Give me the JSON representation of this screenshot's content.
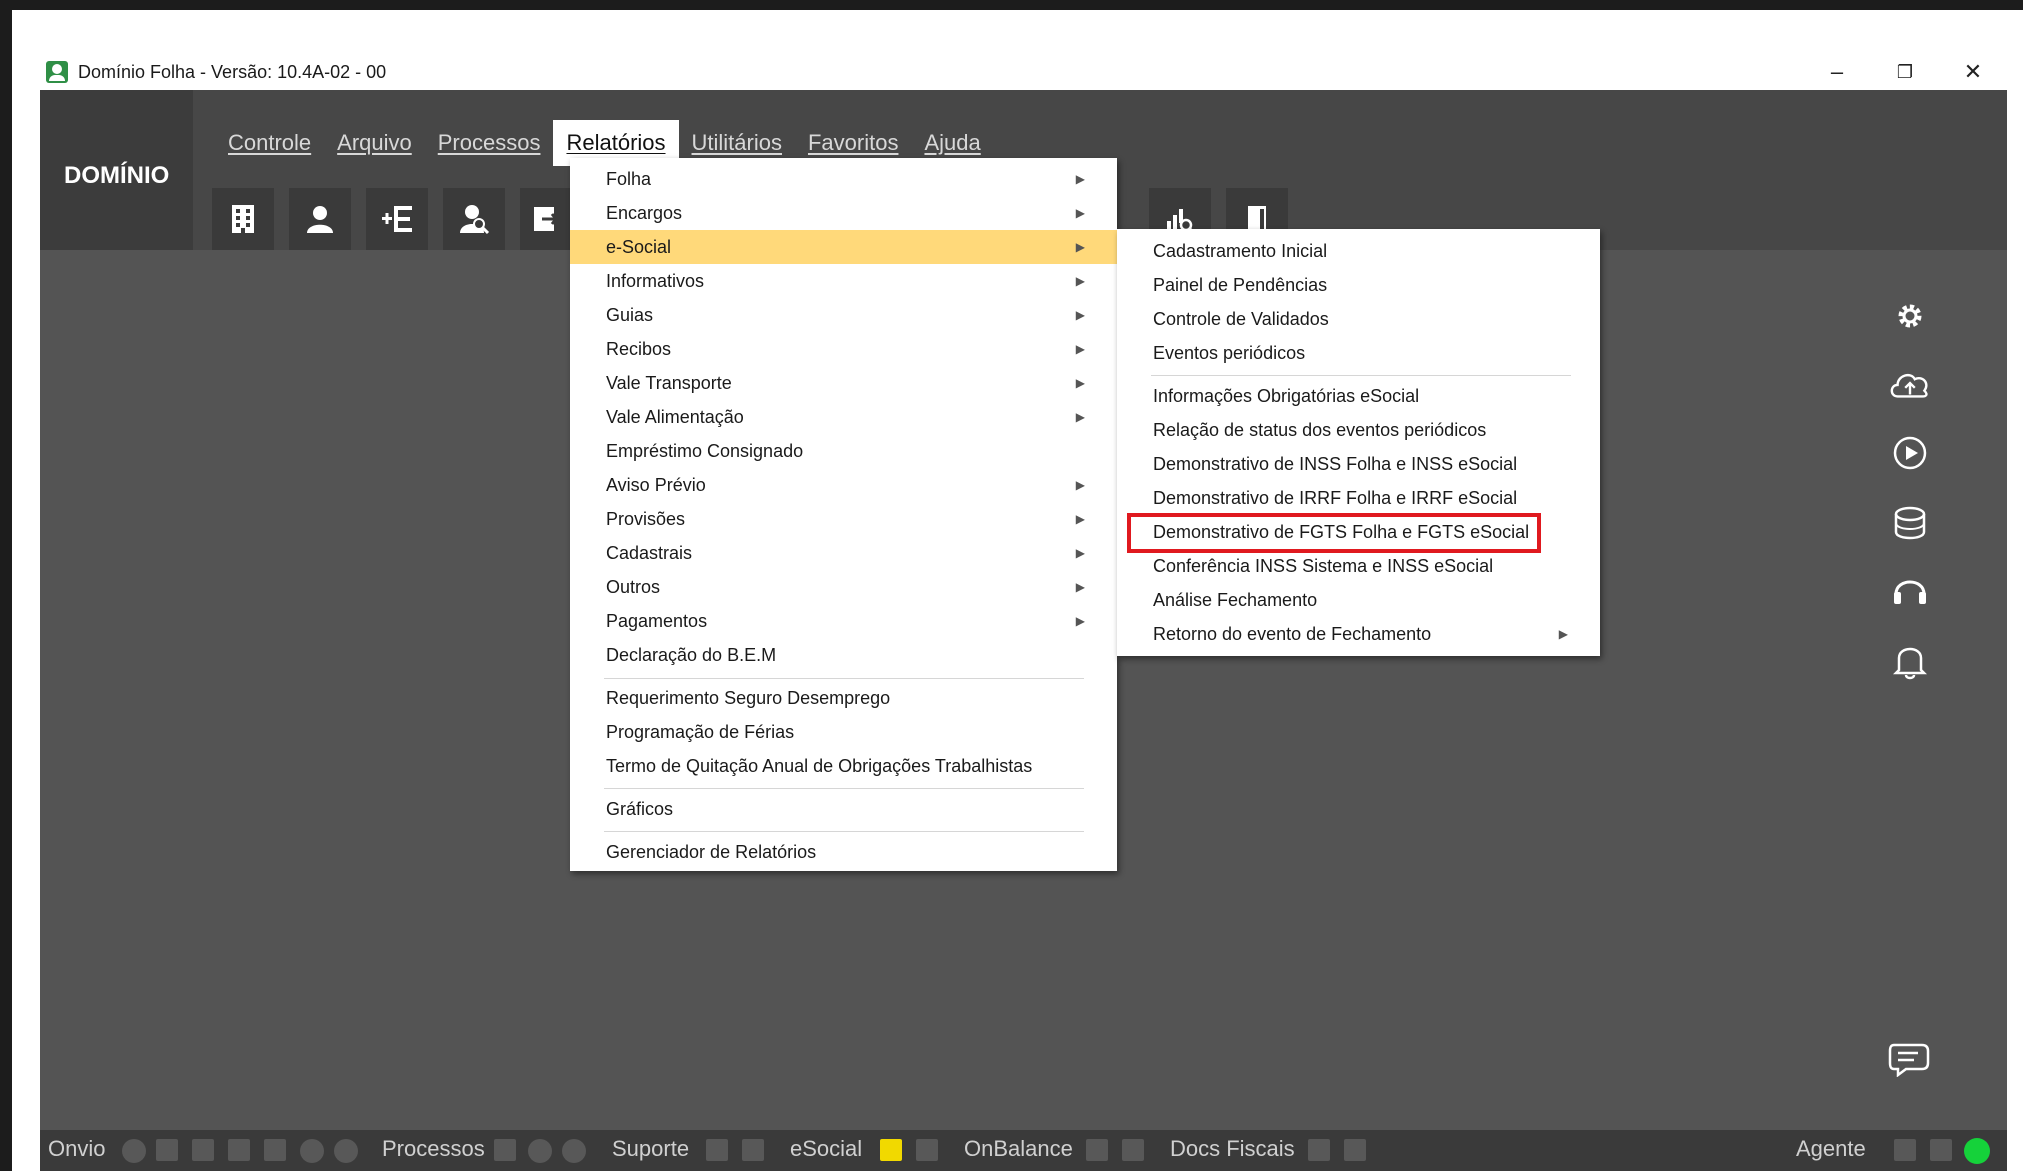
{
  "window": {
    "title": "Domínio Folha - Versão: 10.4A-02 - 00",
    "minimize": "–",
    "restore": "❐",
    "close": "✕"
  },
  "brand": "DOMÍNIO",
  "menubar": {
    "items": [
      {
        "label": "Controle"
      },
      {
        "label": "Arquivo"
      },
      {
        "label": "Processos"
      },
      {
        "label": "Relatórios",
        "active": true
      },
      {
        "label": "Utilitários"
      },
      {
        "label": "Favoritos"
      },
      {
        "label": "Ajuda"
      }
    ]
  },
  "toolbar_icons": [
    "building-icon",
    "employee-icon",
    "add-list-icon",
    "user-search-icon",
    "export-icon",
    "chart-search-icon",
    "door-icon"
  ],
  "relatorios_menu": {
    "items": [
      {
        "label": "Folha",
        "submenu": true
      },
      {
        "label": "Encargos",
        "submenu": true
      },
      {
        "label": "e-Social",
        "submenu": true,
        "highlighted": true
      },
      {
        "label": "Informativos",
        "submenu": true
      },
      {
        "label": "Guias",
        "submenu": true
      },
      {
        "label": "Recibos",
        "submenu": true
      },
      {
        "label": "Vale Transporte",
        "submenu": true
      },
      {
        "label": "Vale Alimentação",
        "submenu": true
      },
      {
        "label": "Empréstimo Consignado",
        "submenu": false
      },
      {
        "label": "Aviso Prévio",
        "submenu": true
      },
      {
        "label": "Provisões",
        "submenu": true
      },
      {
        "label": "Cadastrais",
        "submenu": true
      },
      {
        "label": "Outros",
        "submenu": true
      },
      {
        "label": "Pagamentos",
        "submenu": true
      },
      {
        "label": "Declaração do B.E.M",
        "submenu": false
      },
      {
        "label": "Requerimento Seguro Desemprego",
        "submenu": false
      },
      {
        "label": "Programação de Férias",
        "submenu": false
      },
      {
        "label": "Termo de Quitação Anual de Obrigações Trabalhistas",
        "submenu": false
      },
      {
        "label": "Gráficos",
        "submenu": false
      },
      {
        "label": "Gerenciador de Relatórios",
        "submenu": false
      }
    ]
  },
  "esocial_submenu": {
    "items": [
      {
        "label": "Cadastramento Inicial"
      },
      {
        "label": "Painel de Pendências"
      },
      {
        "label": "Controle de Validados"
      },
      {
        "label": "Eventos periódicos"
      },
      {
        "label": "Informações Obrigatórias eSocial"
      },
      {
        "label": "Relação de status dos eventos periódicos"
      },
      {
        "label": "Demonstrativo de INSS Folha e INSS eSocial"
      },
      {
        "label": "Demonstrativo de IRRF Folha e IRRF eSocial"
      },
      {
        "label": "Demonstrativo de FGTS Folha e FGTS eSocial",
        "highlighted_box": true
      },
      {
        "label": "Conferência INSS Sistema e INSS eSocial"
      },
      {
        "label": "Análise Fechamento"
      },
      {
        "label": "Retorno do evento de Fechamento",
        "submenu": true
      }
    ]
  },
  "side_icons": [
    "settings-icon",
    "cloud-upload-icon",
    "play-icon",
    "database-icon",
    "headset-icon",
    "bell-icon",
    "chat-icon"
  ],
  "statusbar": {
    "onvio": "Onvio",
    "processos": "Processos",
    "suporte": "Suporte",
    "esocial": "eSocial",
    "onbalance": "OnBalance",
    "docs_fiscais": "Docs Fiscais",
    "agente": "Agente"
  },
  "colors": {
    "highlight": "#ffd97a",
    "red_box": "#e0191f",
    "status_green": "#15d23a",
    "status_yellow": "#f1d900"
  }
}
